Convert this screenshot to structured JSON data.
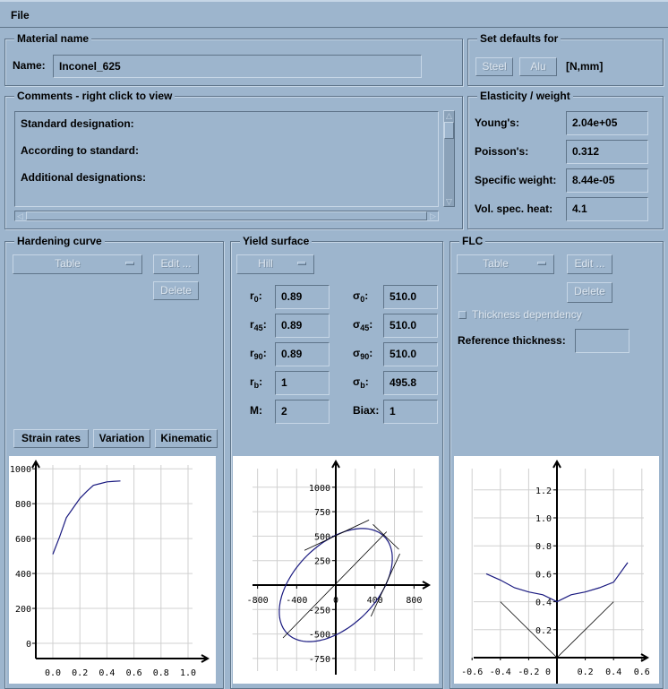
{
  "menu": {
    "file": "File"
  },
  "material": {
    "legend": "Material name",
    "name_label": "Name:",
    "name_value": "Inconel_625"
  },
  "defaults": {
    "legend": "Set defaults for",
    "steel": "Steel",
    "alu": "Alu",
    "units": "[N,mm]"
  },
  "comments": {
    "legend": "Comments - right click to view",
    "lines": [
      "Standard designation:",
      "According to standard:",
      "Additional designations:"
    ]
  },
  "elasticity": {
    "legend": "Elasticity / weight",
    "rows": [
      {
        "label": "Young's:",
        "value": "2.04e+05"
      },
      {
        "label": "Poisson's:",
        "value": "0.312"
      },
      {
        "label": "Specific weight:",
        "value": "8.44e-05"
      },
      {
        "label": "Vol. spec. heat:",
        "value": "4.1"
      }
    ]
  },
  "hardening": {
    "legend": "Hardening curve",
    "type": "Table",
    "edit": "Edit ...",
    "delete": "Delete",
    "strain_rates": "Strain rates",
    "variation": "Variation",
    "kinematic": "Kinematic"
  },
  "yield": {
    "legend": "Yield surface",
    "type": "Hill",
    "r": [
      {
        "base": "r",
        "sub": "0",
        "value": "0.89"
      },
      {
        "base": "r",
        "sub": "45",
        "value": "0.89"
      },
      {
        "base": "r",
        "sub": "90",
        "value": "0.89"
      },
      {
        "base": "r",
        "sub": "b",
        "value": "1"
      },
      {
        "base": "M",
        "sub": "",
        "value": "2"
      }
    ],
    "sigma": [
      {
        "base": "σ",
        "sub": "0",
        "value": "510.0"
      },
      {
        "base": "σ",
        "sub": "45",
        "value": "510.0"
      },
      {
        "base": "σ",
        "sub": "90",
        "value": "510.0"
      },
      {
        "base": "σ",
        "sub": "b",
        "value": "495.8"
      },
      {
        "base": "Biax",
        "sub": "",
        "value": "1"
      }
    ]
  },
  "flc": {
    "legend": "FLC",
    "type": "Table",
    "edit": "Edit ...",
    "delete": "Delete",
    "thickness_dependency": "Thickness dependency",
    "thickness_dependency_checked": false,
    "reference_thickness_label": "Reference thickness:",
    "reference_thickness_value": ""
  },
  "colors": {
    "curve": "#1a1a80",
    "background": "#9db5cd",
    "grid": "#d0d0d0"
  },
  "chart_data": [
    {
      "id": "hardening",
      "type": "line",
      "title": "",
      "xlabel": "",
      "ylabel": "",
      "xlim": [
        -0.1,
        1.1
      ],
      "ylim": [
        -60,
        1030
      ],
      "xticks": [
        "0.0",
        "0.2",
        "0.4",
        "0.6",
        "0.8",
        "1.0"
      ],
      "xtick_values": [
        0,
        0.2,
        0.4,
        0.6,
        0.8,
        1.0
      ],
      "yticks": [
        "0",
        "200",
        "400",
        "600",
        "800",
        "1000"
      ],
      "ytick_values": [
        0,
        200,
        400,
        600,
        800,
        1000
      ],
      "grid": true,
      "series": [
        {
          "name": "hardening",
          "x": [
            0.0,
            0.05,
            0.1,
            0.15,
            0.2,
            0.25,
            0.3,
            0.35,
            0.4,
            0.45,
            0.5
          ],
          "y": [
            510,
            610,
            720,
            775,
            830,
            870,
            905,
            915,
            925,
            928,
            930
          ]
        }
      ]
    },
    {
      "id": "yield",
      "type": "line",
      "title": "",
      "xlim": [
        -850,
        850
      ],
      "ylim": [
        -850,
        1200
      ],
      "xticks": [
        "-800",
        "-400",
        "0",
        "400",
        "800"
      ],
      "xtick_values": [
        -800,
        -400,
        0,
        400,
        800
      ],
      "yticks": [
        "-750",
        "-500",
        "-250",
        "250",
        "500",
        "750",
        "1000"
      ],
      "ytick_values": [
        -750,
        -500,
        -250,
        250,
        500,
        750,
        1000
      ],
      "grid": true,
      "ellipse": {
        "sigma0": 510.0,
        "sigma90": 510.0,
        "sigmab": 495.8,
        "r0": 0.89,
        "r90": 0.89
      },
      "annotations": [
        {
          "name": "biaxial-diagonal",
          "x": [
            -540,
            520
          ],
          "y": [
            -540,
            545
          ]
        },
        {
          "name": "tangent-top",
          "x": [
            -320,
            340
          ],
          "y": [
            355,
            665
          ]
        },
        {
          "name": "tangent-biax",
          "x": [
            380,
            645
          ],
          "y": [
            620,
            365
          ]
        },
        {
          "name": "tangent-right",
          "x": [
            360,
            655
          ],
          "y": [
            -320,
            320
          ]
        }
      ]
    },
    {
      "id": "flc",
      "type": "line",
      "title": "",
      "xlim": [
        -0.65,
        0.65
      ],
      "ylim": [
        -0.02,
        1.38
      ],
      "xticks": [
        "-0.6",
        "-0.4",
        "-0.2",
        "0",
        "0.2",
        "0.4",
        "0.6"
      ],
      "xtick_values": [
        -0.6,
        -0.4,
        -0.2,
        0,
        0.2,
        0.4,
        0.6
      ],
      "yticks": [
        "0.2",
        "0.4",
        "0.6",
        "0.8",
        "1.0",
        "1.2"
      ],
      "ytick_values": [
        0.2,
        0.4,
        0.6,
        0.8,
        1.0,
        1.2
      ],
      "grid": true,
      "series": [
        {
          "name": "FLC",
          "x": [
            -0.5,
            -0.4,
            -0.3,
            -0.2,
            -0.1,
            0.0,
            0.1,
            0.2,
            0.3,
            0.4,
            0.5
          ],
          "y": [
            0.6,
            0.555,
            0.5,
            0.47,
            0.45,
            0.4,
            0.45,
            0.47,
            0.5,
            0.54,
            0.68
          ]
        }
      ],
      "annotations": [
        {
          "name": "strain-path-left",
          "x": [
            -0.4,
            0.0
          ],
          "y": [
            0.4,
            0.0
          ]
        },
        {
          "name": "strain-path-right",
          "x": [
            0.0,
            0.4
          ],
          "y": [
            0.0,
            0.4
          ]
        }
      ]
    }
  ]
}
